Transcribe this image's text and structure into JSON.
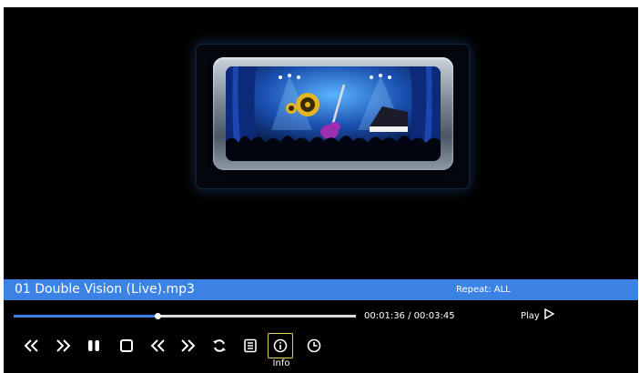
{
  "player": {
    "track_title": "01 Double Vision (Live).mp3",
    "repeat_label": "Repeat: ALL",
    "progress_fraction": 0.42,
    "time_readout": "00:01:36 / 00:03:45",
    "status_label": "Play",
    "focused_control_label": "Info"
  },
  "colors": {
    "accent": "#3c82e4",
    "focus_border": "#e4d84a",
    "background": "#000000"
  },
  "controls": [
    {
      "icon": "skip-previous-icon"
    },
    {
      "icon": "skip-next-icon"
    },
    {
      "icon": "pause-icon"
    },
    {
      "icon": "stop-icon"
    },
    {
      "icon": "rewind-icon"
    },
    {
      "icon": "fast-forward-icon"
    },
    {
      "icon": "repeat-icon"
    },
    {
      "icon": "playlist-icon"
    },
    {
      "icon": "info-icon",
      "focused": true
    },
    {
      "icon": "sleep-timer-icon"
    }
  ]
}
